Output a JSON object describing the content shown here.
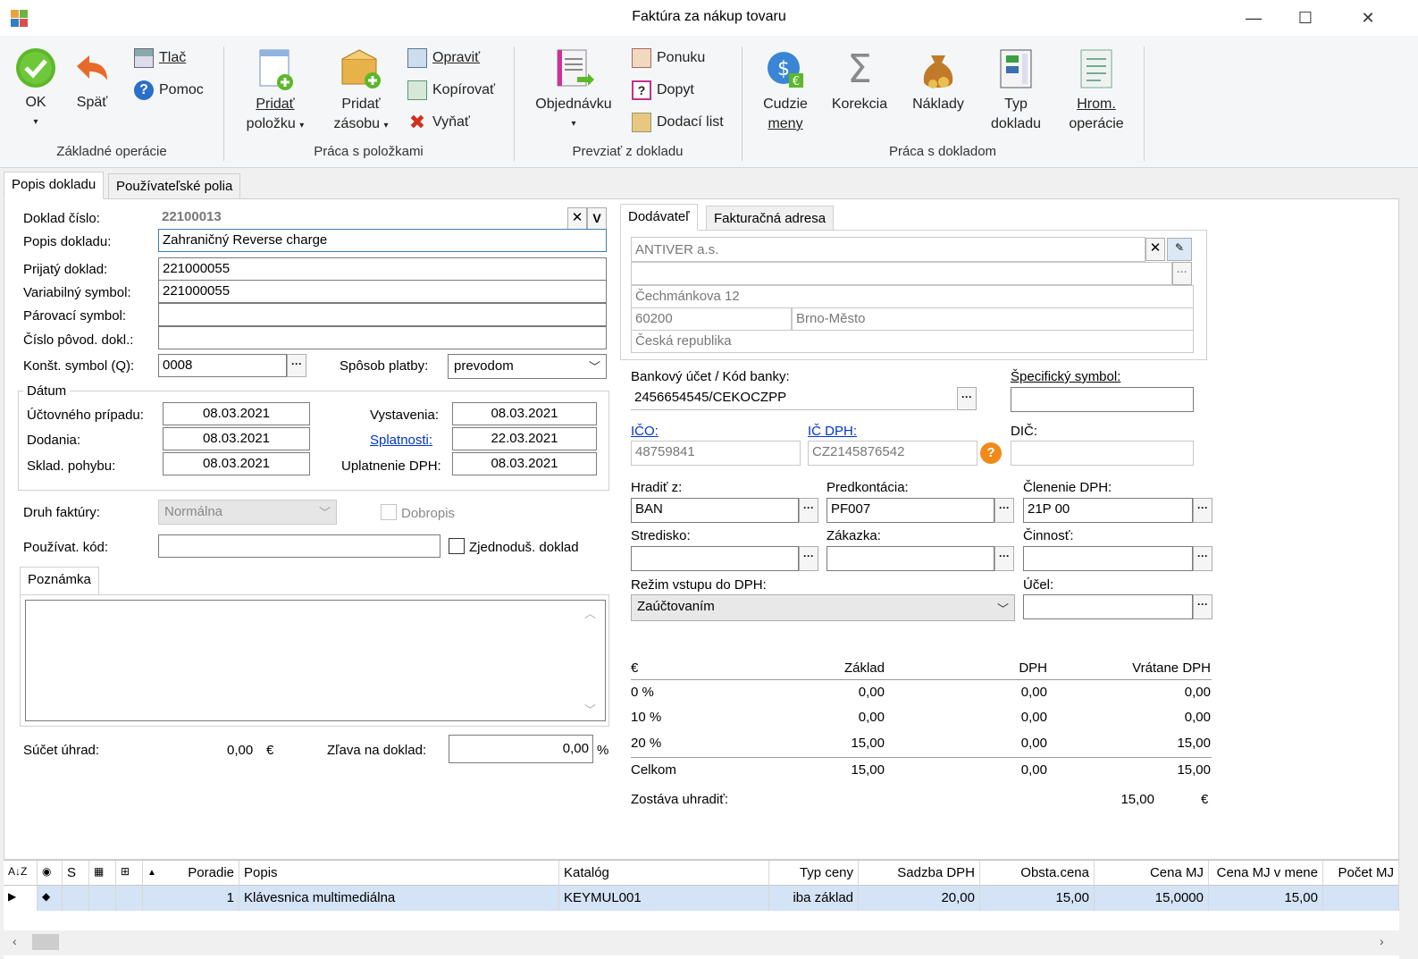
{
  "window": {
    "title": "Faktúra za nákup tovaru"
  },
  "ribbon": {
    "groups": {
      "basic": "Základné operácie",
      "items": "Práca s položkami",
      "take": "Prevziať z dokladu",
      "doc": "Práca s dokladom"
    },
    "ok": "OK",
    "back": "Späť",
    "print": "Tlač",
    "help": "Pomoc",
    "add_item": [
      "Pridať",
      "položku"
    ],
    "add_stock": [
      "Pridať",
      "zásobu"
    ],
    "edit": "Opraviť",
    "copy": "Kopírovať",
    "cut": "Vyňať",
    "order": "Objednávku",
    "offer": "Ponuku",
    "inquiry": "Dopyt",
    "delivery": "Dodací list",
    "foreign": [
      "Cudzie",
      "meny"
    ],
    "correction": "Korekcia",
    "costs": "Náklady",
    "doc_type": [
      "Typ",
      "dokladu"
    ],
    "bulk": [
      "Hrom.",
      "operácie"
    ]
  },
  "tabs": {
    "description": "Popis dokladu",
    "user_fields": "Používateľské polia"
  },
  "form": {
    "doc_number_label": "Doklad číslo:",
    "doc_number": "22100013",
    "doc_desc_label": "Popis dokladu:",
    "doc_desc": "Zahraničný Reverse charge",
    "received_label": "Prijatý doklad:",
    "received": "221000055",
    "variable_label": "Variabilný symbol:",
    "variable": "221000055",
    "pairing_label": "Párovací symbol:",
    "pairing": "",
    "orig_label": "Číslo pôvod. dokl.:",
    "orig": "",
    "const_label": "Konšt. symbol (Q):",
    "const": "0008",
    "payment_label": "Spôsob platby:",
    "payment": "prevodom",
    "dates_title": "Dátum",
    "date_case_label": "Účtovného prípadu:",
    "date_case": "08.03.2021",
    "date_delivery_label": "Dodania:",
    "date_delivery": "08.03.2021",
    "date_stock_label": "Sklad. pohybu:",
    "date_stock": "08.03.2021",
    "date_issue_label": "Vystavenia:",
    "date_issue": "08.03.2021",
    "date_due_label": "Splatnosti:",
    "date_due": "22.03.2021",
    "date_vat_label": "Uplatnenie DPH:",
    "date_vat": "08.03.2021",
    "invoice_kind_label": "Druh faktúry:",
    "invoice_kind": "Normálna",
    "credit_note": "Dobropis",
    "user_code_label": "Používat. kód:",
    "user_code": "",
    "simplified": "Zjednoduš. doklad",
    "note_tab": "Poznámka",
    "sum_payments_label": "Súčet úhrad:",
    "sum_payments": "0,00",
    "currency": "€",
    "discount_label": "Zľava na doklad:",
    "discount": "0,00",
    "percent": "%"
  },
  "supplier": {
    "tab_supplier": "Dodávateľ",
    "tab_invoice_addr": "Fakturačná adresa",
    "name": "ANTIVER a.s.",
    "street": "Čechmánkova 12",
    "zip": "60200",
    "city": "Brno-Město",
    "country": "Česká republika",
    "bank_label": "Bankový účet / Kód banky:",
    "bank": "2456654545/CEKOCZPP",
    "specific_label": "Špecifický symbol:",
    "specific": "",
    "ico_label": "IČO:",
    "ico": "48759841",
    "icdph_label": "IČ DPH:",
    "icdph": "CZ2145876542",
    "dic_label": "DIČ:",
    "dic": "",
    "pay_from_label": "Hradiť z:",
    "pay_from": "BAN",
    "precont_label": "Predkontácia:",
    "precont": "PF007",
    "vat_split_label": "Členenie DPH:",
    "vat_split": "21P 00",
    "center_label": "Stredisko:",
    "center": "",
    "contract_label": "Zákazka:",
    "contract": "",
    "activity_label": "Činnosť:",
    "activity": "",
    "vat_mode_label": "Režim vstupu do DPH:",
    "vat_mode": "Zaúčtovaním",
    "purpose_label": "Účel:",
    "purpose": ""
  },
  "vat_table": {
    "headers": [
      "€",
      "Základ",
      "DPH",
      "Vrátane DPH"
    ],
    "rows": [
      [
        "0 %",
        "0,00",
        "0,00",
        "0,00"
      ],
      [
        "10 %",
        "0,00",
        "0,00",
        "0,00"
      ],
      [
        "20 %",
        "15,00",
        "0,00",
        "15,00"
      ]
    ],
    "total": [
      "Celkom",
      "15,00",
      "0,00",
      "15,00"
    ],
    "remaining_label": "Zostáva uhradiť:",
    "remaining": "15,00",
    "remaining_currency": "€"
  },
  "grid": {
    "headers": [
      "S",
      "Poradie",
      "Popis",
      "Katalóg",
      "Typ ceny",
      "Sadzba DPH",
      "Obsta.cena",
      "Cena MJ",
      "Cena MJ v mene",
      "Počet MJ"
    ],
    "row": [
      "1",
      "Klávesnica multimediálna",
      "KEYMUL001",
      "iba základ",
      "20,00",
      "15,00",
      "15,0000",
      "15,00"
    ]
  },
  "colors": {
    "accent": "#0033cc",
    "selected_row": "#d4e3f5"
  }
}
